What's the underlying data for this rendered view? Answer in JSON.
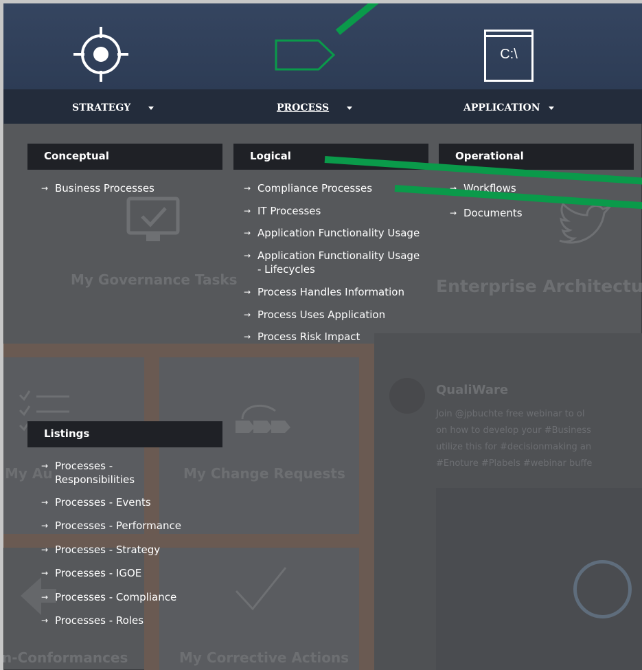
{
  "background": {
    "tiles": {
      "governance": "My Governance Tasks",
      "enterprise": "Enterprise Architectu",
      "change_requests": "My Change Requests",
      "my_audits": "My Au",
      "non_conformances": "n-Conformances",
      "corrective_actions": "My Corrective Actions"
    },
    "tweet": {
      "author": "QualiWare",
      "lines": [
        "Join @jpbuchte free webinar to ol",
        "on how to develop your #Business",
        "utilize this for #decisionmaking an",
        "#Enoture #Plabels #webinar buffe"
      ]
    }
  },
  "nav": {
    "strategy": "STRATEGY",
    "process": "PROCESS",
    "application": "APPLICATION",
    "application_icon_text": "C:\\"
  },
  "menu": {
    "conceptual": {
      "heading": "Conceptual",
      "items": [
        "Business Processes"
      ]
    },
    "logical": {
      "heading": "Logical",
      "items": [
        "Compliance Processes",
        "IT Processes",
        "Application Functionality Usage",
        "Application Functionality Usage - Lifecycles",
        "Process Handles Information",
        "Process Uses Application",
        "Process Risk Impact"
      ]
    },
    "operational": {
      "heading": "Operational",
      "items": [
        "Workflows",
        "Documents"
      ]
    },
    "listings": {
      "heading": "Listings",
      "items": [
        "Processes - Responsibilities",
        "Processes - Events",
        "Processes - Performance",
        "Processes - Strategy",
        "Processes - IGOE",
        "Processes - Compliance",
        "Processes - Roles"
      ]
    }
  },
  "colors": {
    "annotation_green": "#0a9a4a",
    "header": "#2d3c55",
    "menu_heading_bg": "#1f2126"
  }
}
